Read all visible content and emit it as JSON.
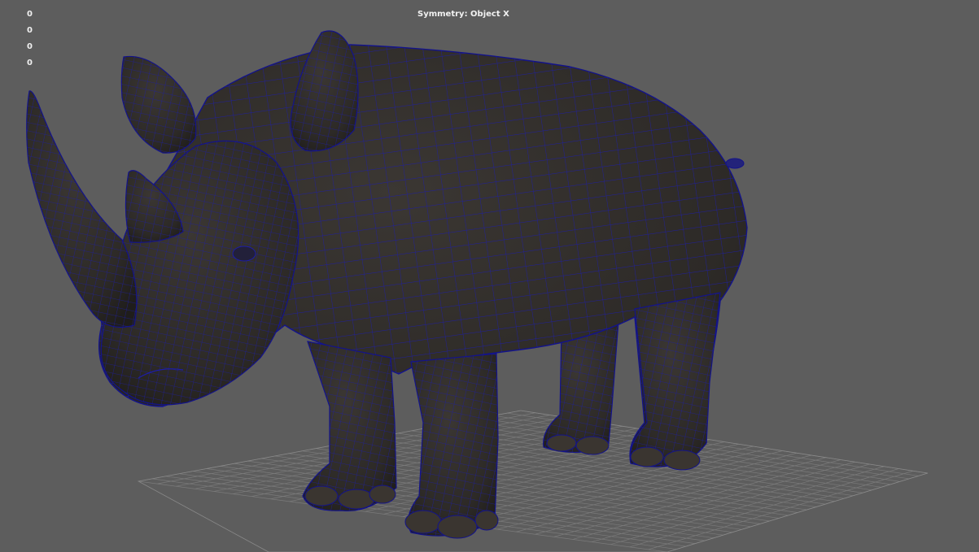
{
  "viewport": {
    "symmetry_label": "Symmetry: Object X",
    "hud_values": [
      "0",
      "0",
      "0",
      "0",
      "0"
    ],
    "model": "rhinoceros-mesh",
    "colors": {
      "background": "#5d5d5d",
      "mesh_fill": "#2f2c29",
      "wireframe": "#1a1aa0",
      "grid": "#7a7a7a"
    }
  }
}
